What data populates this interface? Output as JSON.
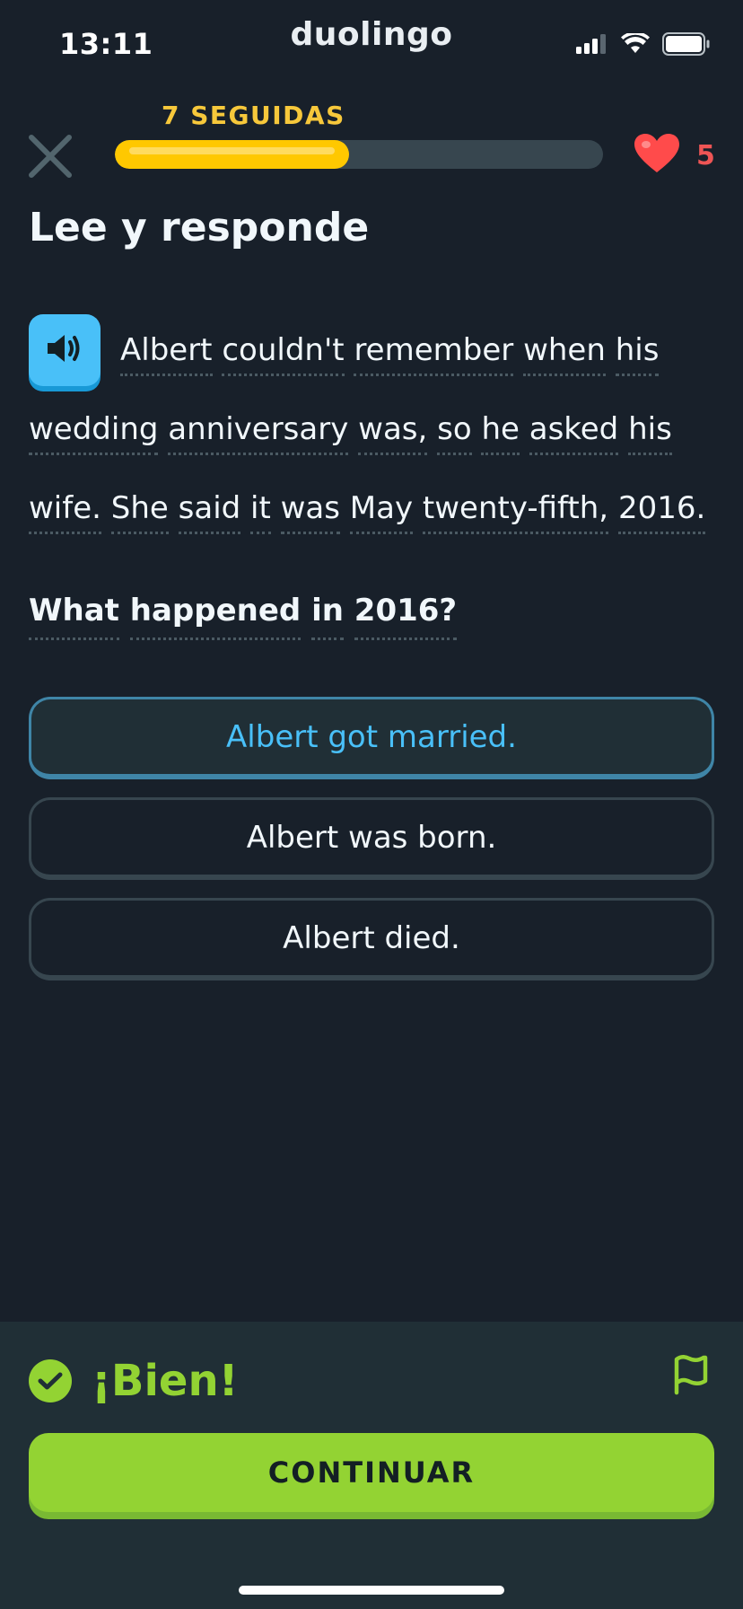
{
  "status_bar": {
    "time": "13:11",
    "app_name": "duolingo",
    "icons": [
      "signal-icon",
      "wifi-icon",
      "battery-icon"
    ]
  },
  "header": {
    "streak_label": "7 SEGUIDAS",
    "progress_fraction": 0.48,
    "hearts_count": "5",
    "icons": [
      "close-icon",
      "heart-icon"
    ]
  },
  "exercise": {
    "title": "Lee y responde",
    "passage_words": [
      "Albert",
      "couldn't",
      "remember",
      "when",
      "his",
      "wedding",
      "anniversary",
      "was,",
      "so",
      "he",
      "asked",
      "his",
      "wife.",
      "She",
      "said",
      "it",
      "was",
      "May",
      "twenty-fifth,",
      "2016."
    ],
    "question_words": [
      "What",
      "happened",
      "in",
      "2016?"
    ],
    "options": [
      {
        "label": "Albert got married.",
        "selected": true
      },
      {
        "label": "Albert was born.",
        "selected": false
      },
      {
        "label": "Albert died.",
        "selected": false
      }
    ]
  },
  "feedback": {
    "message": "¡Bien!",
    "continue_label": "CONTINUAR"
  },
  "colors": {
    "background": "#18202a",
    "streak": "#f7c83b",
    "progress": "#ffc800",
    "heart": "#ee5555",
    "selected_option": "#49c0f8",
    "success": "#93d333"
  }
}
